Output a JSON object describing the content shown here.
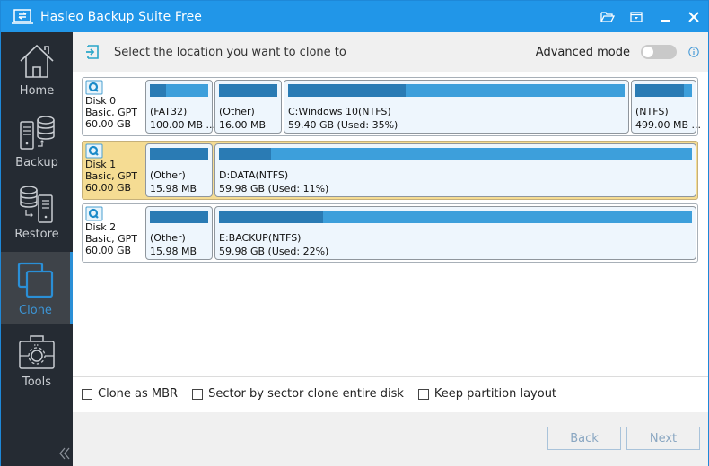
{
  "app": {
    "title": "Hasleo Backup Suite Free",
    "title_controls": [
      "folder-open-icon",
      "dropdown-menu-icon",
      "minimize-icon",
      "close-icon"
    ]
  },
  "sidebar": {
    "items": [
      {
        "label": "Home",
        "icon": "home-icon",
        "active": false
      },
      {
        "label": "Backup",
        "icon": "backup-icon",
        "active": false
      },
      {
        "label": "Restore",
        "icon": "restore-icon",
        "active": false
      },
      {
        "label": "Clone",
        "icon": "clone-icon",
        "active": true
      },
      {
        "label": "Tools",
        "icon": "tools-icon",
        "active": false
      }
    ],
    "collapse_icon": "double-chevron-left-icon"
  },
  "header": {
    "instruction": "Select the location you want to clone to",
    "advanced_mode_label": "Advanced mode",
    "advanced_mode_on": false
  },
  "disks": [
    {
      "name": "Disk 0",
      "type": "Basic, GPT",
      "size": "60.00 GB",
      "selected": false,
      "partitions": [
        {
          "label": "(FAT32)",
          "detail": "100.00 MB ...",
          "used_fraction": 0.27
        },
        {
          "label": "(Other)",
          "detail": "16.00 MB",
          "used_fraction": 1.0
        },
        {
          "label": "C:Windows 10(NTFS)",
          "detail": "59.40 GB (Used: 35%)",
          "used_fraction": 0.35
        },
        {
          "label": "(NTFS)",
          "detail": "499.00 MB ...",
          "used_fraction": 0.85
        }
      ]
    },
    {
      "name": "Disk 1",
      "type": "Basic, GPT",
      "size": "60.00 GB",
      "selected": true,
      "partitions": [
        {
          "label": "(Other)",
          "detail": "15.98 MB",
          "used_fraction": 1.0
        },
        {
          "label": "D:DATA(NTFS)",
          "detail": "59.98 GB (Used: 11%)",
          "used_fraction": 0.11
        }
      ]
    },
    {
      "name": "Disk 2",
      "type": "Basic, GPT",
      "size": "60.00 GB",
      "selected": false,
      "partitions": [
        {
          "label": "(Other)",
          "detail": "15.98 MB",
          "used_fraction": 1.0
        },
        {
          "label": "E:BACKUP(NTFS)",
          "detail": "59.98 GB (Used: 22%)",
          "used_fraction": 0.22
        }
      ]
    }
  ],
  "options": [
    {
      "label": "Clone as MBR",
      "checked": false
    },
    {
      "label": "Sector by sector clone entire disk",
      "checked": false
    },
    {
      "label": "Keep partition layout",
      "checked": false
    }
  ],
  "footer": {
    "back_label": "Back",
    "next_label": "Next"
  },
  "colors": {
    "titlebar": "#2196e8",
    "sidebar": "#252b33",
    "accent": "#3c95d6",
    "selected_disk": "#f5dc93",
    "bar_free": "#3d9fdb",
    "bar_used": "#2a7bb4"
  }
}
